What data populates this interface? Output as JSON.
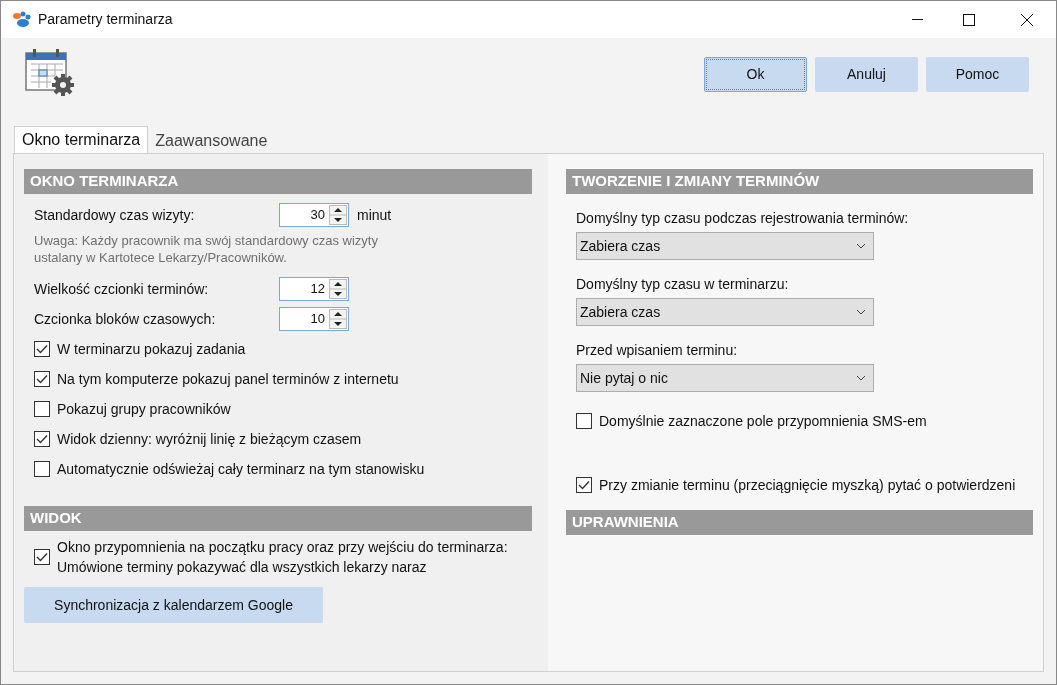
{
  "window": {
    "title": "Parametry terminarza"
  },
  "buttons": [
    {
      "label": "Ok",
      "focused": true
    },
    {
      "label": "Anuluj",
      "focused": false
    },
    {
      "label": "Pomoc",
      "focused": false
    }
  ],
  "tabs": [
    {
      "label": "Okno terminarza",
      "selected": true
    },
    {
      "label": "Zaawansowane",
      "selected": false
    }
  ],
  "left": {
    "sections": [
      {
        "title": "OKNO TERMINARZA",
        "items": [
          {
            "kind": "spin",
            "label": "Standardowy czas wizyty:",
            "value": "30",
            "unit": "minut"
          },
          {
            "kind": "note",
            "text": "Uwaga: Każdy pracownik ma swój standardowy czas wizyty ustalany w Kartotece Lekarzy/Pracowników."
          },
          {
            "kind": "spin",
            "label": "Wielkość czcionki terminów:",
            "value": "12"
          },
          {
            "kind": "spin",
            "label": "Czcionka bloków czasowych:",
            "value": "10"
          },
          {
            "kind": "check",
            "label": "W terminarzu pokazuj zadania",
            "checked": true
          },
          {
            "kind": "check",
            "label": "Na tym komputerze pokazuj panel terminów z internetu",
            "checked": true
          },
          {
            "kind": "check",
            "label": "Pokazuj grupy pracowników",
            "checked": false
          },
          {
            "kind": "check",
            "label": "Widok dzienny: wyróżnij linię z bieżącym czasem",
            "checked": true
          },
          {
            "kind": "check",
            "label": "Automatycznie odświeżaj cały terminarz na tym stanowisku",
            "checked": false
          }
        ]
      },
      {
        "title": "WIDOK",
        "items": [
          {
            "kind": "check",
            "label": "Okno przypomnienia na początku pracy oraz przy wejściu do terminarza: Umówione terminy pokazywać dla wszystkich lekarzy naraz",
            "checked": true
          },
          {
            "kind": "button",
            "label": "Synchronizacja z kalendarzem Google"
          }
        ]
      }
    ]
  },
  "right": {
    "sections": [
      {
        "title": "TWORZENIE I ZMIANY TERMINÓW",
        "items": [
          {
            "kind": "select",
            "label": "Domyślny typ czasu podczas rejestrowania terminów:",
            "value": "Zabiera czas"
          },
          {
            "kind": "select",
            "label": "Domyślny typ czasu w terminarzu:",
            "value": "Zabiera czas"
          },
          {
            "kind": "select",
            "label": "Przed wpisaniem terminu:",
            "value": "Nie pytaj o nic"
          },
          {
            "kind": "check",
            "label": "Domyślnie zaznaczone pole przypomnienia SMS-em",
            "checked": false
          },
          {
            "kind": "check",
            "label": "Przy zmianie terminu (przeciągnięcie myszką) pytać o potwierdzeni",
            "checked": true
          }
        ]
      },
      {
        "title": "UPRAWNIENIA"
      }
    ]
  }
}
